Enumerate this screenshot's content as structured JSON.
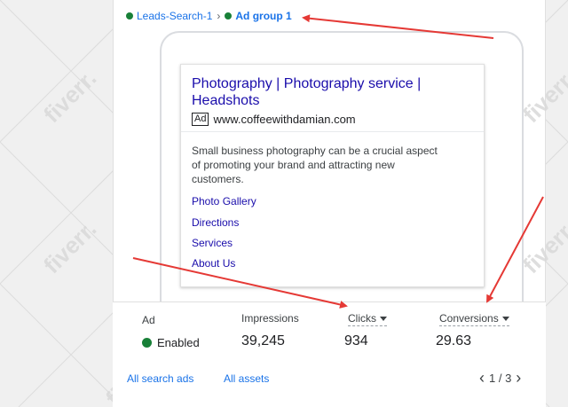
{
  "breadcrumb": {
    "campaign": "Leads-Search-1",
    "separator": "›",
    "ad_group": "Ad group 1"
  },
  "ad_preview": {
    "title_line1": "Photography | Photography service |",
    "title_line2": "Headshots",
    "badge": "Ad",
    "display_url": "www.coffeewithdamian.com",
    "description_lines": [
      "Small business photography can be a crucial aspect",
      "of promoting your brand and attracting new",
      "customers."
    ],
    "sitelinks": [
      "Photo Gallery",
      "Directions",
      "Services",
      "About Us"
    ]
  },
  "stats": {
    "ad_label": "Ad",
    "status": "Enabled",
    "impressions_label": "Impressions",
    "impressions_value": "39,245",
    "clicks_label": "Clicks",
    "clicks_value": "934",
    "conversions_label": "Conversions",
    "conversions_value": "29.63"
  },
  "footer": {
    "all_search_ads": "All search ads",
    "all_assets": "All assets",
    "pagination": "1 / 3"
  },
  "watermark": "fiverr.",
  "colors": {
    "status_green": "#188038",
    "link_blue": "#1a73e8",
    "ad_title": "#1a0dab",
    "annotation_arrow": "#e53935"
  }
}
